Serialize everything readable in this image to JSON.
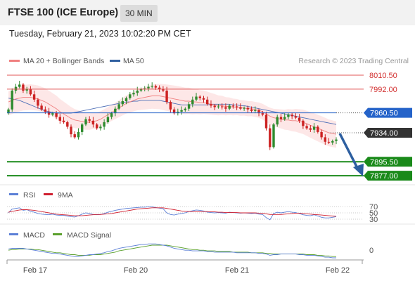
{
  "header": {
    "title": "FTSE 100 (ICE Europe)",
    "interval": "30 MIN"
  },
  "datetime": "Tuesday, February 21, 2023 10:02:20 PM CET",
  "legend": {
    "ma20": "MA 20 + Bollinger Bands",
    "ma50": "MA 50",
    "credit": "Research © 2023 Trading Central"
  },
  "colors": {
    "ma20": "#f08080",
    "ma50": "#3060a0",
    "up": "#2e8b2e",
    "down": "#cc2222",
    "support": "#1a8a1a",
    "resistance": "#e05555",
    "pivot": "#2563c9",
    "price": "#333333",
    "arrow": "#2d5fa0",
    "rsi": "#5b7fd6",
    "rsi_ma": "#d02030",
    "macd": "#5b7fd6",
    "macd_signal": "#5aa02c"
  },
  "chart_data": [
    {
      "type": "line",
      "subtype": "candlestick_with_levels",
      "title": "FTSE 100 (ICE Europe)",
      "x_ticks": [
        "Feb 17",
        "Feb 20",
        "Feb 21",
        "Feb 22"
      ],
      "ylim": [
        7870,
        8020
      ],
      "levels": [
        {
          "value": 8010.5,
          "label": "8010.50",
          "kind": "resistance"
        },
        {
          "value": 7992.0,
          "label": "7992.00",
          "kind": "resistance"
        },
        {
          "value": 7960.5,
          "label": "7960.50",
          "kind": "pivot"
        },
        {
          "value": 7934.0,
          "label": "7934.00",
          "kind": "last"
        },
        {
          "value": 7895.5,
          "label": "7895.50",
          "kind": "support"
        },
        {
          "value": 7877.0,
          "label": "7877.00",
          "kind": "support"
        }
      ],
      "close": [
        7965,
        7990,
        7995,
        7998,
        7990,
        7992,
        7985,
        7978,
        7970,
        7965,
        7962,
        7958,
        7960,
        7955,
        7950,
        7948,
        7942,
        7932,
        7928,
        7935,
        7945,
        7952,
        7950,
        7945,
        7940,
        7942,
        7948,
        7955,
        7960,
        7966,
        7972,
        7976,
        7980,
        7985,
        7987,
        7990,
        7992,
        7993,
        7995,
        7996,
        7994,
        7992,
        7990,
        7975,
        7965,
        7960,
        7962,
        7964,
        7966,
        7972,
        7978,
        7982,
        7980,
        7978,
        7972,
        7970,
        7968,
        7969,
        7968,
        7966,
        7970,
        7969,
        7968,
        7966,
        7967,
        7965,
        7963,
        7964,
        7960,
        7958,
        7940,
        7915,
        7945,
        7955,
        7952,
        7955,
        7958,
        7956,
        7954,
        7950,
        7943,
        7940,
        7938,
        7942,
        7935,
        7928,
        7922,
        7921,
        7923,
        7925
      ],
      "ma20": [
        7975,
        7977,
        7979,
        7980,
        7981,
        7981,
        7981,
        7980,
        7979,
        7977,
        7975,
        7972,
        7969,
        7966,
        7962,
        7959,
        7956,
        7953,
        7951,
        7950,
        7949,
        7948,
        7948,
        7949,
        7950,
        7952,
        7955,
        7958,
        7961,
        7964,
        7967,
        7970,
        7973,
        7975,
        7977,
        7979,
        7980,
        7981,
        7982,
        7983,
        7983,
        7983,
        7982,
        7981,
        7980,
        7979,
        7978,
        7977,
        7976,
        7976,
        7975,
        7975,
        7974,
        7974,
        7973,
        7972,
        7971,
        7970,
        7970,
        7969,
        7969,
        7968,
        7968,
        7967,
        7967,
        7966,
        7966,
        7965,
        7964,
        7962,
        7959,
        7956,
        7954,
        7953,
        7952,
        7951,
        7951,
        7950,
        7950,
        7949,
        7948,
        7946,
        7944,
        7942,
        7940,
        7938,
        7936,
        7934,
        7933,
        7932
      ],
      "ma50": [
        7980,
        7979,
        7978,
        7977,
        7975,
        7973,
        7971,
        7969,
        7967,
        7965,
        7963,
        7962,
        7961,
        7960,
        7960,
        7960,
        7960,
        7960,
        7961,
        7962,
        7963,
        7964,
        7965,
        7966,
        7967,
        7968,
        7969,
        7970,
        7971,
        7972,
        7973,
        7974,
        7975,
        7975,
        7976,
        7976,
        7977,
        7977,
        7977,
        7977,
        7977,
        7977,
        7976,
        7975,
        7974,
        7973,
        7972,
        7971,
        7971,
        7971,
        7971,
        7971,
        7971,
        7971,
        7971,
        7972,
        7972,
        7972,
        7972,
        7972,
        7972,
        7971,
        7971,
        7970,
        7970,
        7969,
        7968,
        7967,
        7966,
        7965,
        7964,
        7963,
        7962,
        7961,
        7960,
        7959,
        7958,
        7957,
        7956,
        7955,
        7954,
        7953,
        7952,
        7951,
        7950,
        7949,
        7948,
        7947,
        7946,
        7945
      ]
    },
    {
      "type": "line",
      "title": "RSI",
      "series": [
        {
          "name": "RSI"
        },
        {
          "name": "9MA"
        }
      ],
      "y_ticks": [
        70,
        50,
        30
      ],
      "ylim": [
        0,
        100
      ],
      "rsi": [
        50,
        62,
        64,
        66,
        58,
        60,
        55,
        52,
        48,
        46,
        45,
        44,
        46,
        43,
        42,
        42,
        40,
        38,
        37,
        41,
        46,
        50,
        48,
        45,
        44,
        45,
        48,
        52,
        55,
        58,
        60,
        62,
        64,
        65,
        66,
        67,
        68,
        68,
        69,
        69,
        67,
        65,
        63,
        50,
        45,
        43,
        46,
        48,
        50,
        54,
        57,
        59,
        58,
        56,
        52,
        51,
        50,
        51,
        50,
        49,
        52,
        51,
        50,
        49,
        50,
        49,
        48,
        49,
        46,
        45,
        35,
        28,
        48,
        52,
        50,
        52,
        54,
        52,
        51,
        48,
        44,
        42,
        41,
        44,
        40,
        36,
        34,
        34,
        36,
        38
      ],
      "rsi_ma": [
        52,
        55,
        57,
        59,
        60,
        60,
        59,
        58,
        56,
        54,
        52,
        50,
        48,
        46,
        45,
        44,
        43,
        42,
        41,
        41,
        41,
        42,
        43,
        44,
        45,
        45,
        46,
        47,
        48,
        50,
        52,
        54,
        56,
        58,
        60,
        62,
        63,
        64,
        65,
        66,
        66,
        66,
        66,
        64,
        62,
        60,
        58,
        56,
        55,
        54,
        54,
        54,
        54,
        54,
        54,
        53,
        53,
        52,
        52,
        51,
        51,
        51,
        51,
        50,
        50,
        50,
        50,
        50,
        49,
        49,
        47,
        45,
        45,
        45,
        45,
        46,
        47,
        48,
        49,
        49,
        48,
        47,
        46,
        45,
        44,
        43,
        42,
        41,
        40,
        39
      ]
    },
    {
      "type": "line",
      "title": "MACD",
      "series": [
        {
          "name": "MACD"
        },
        {
          "name": "MACD Signal"
        }
      ],
      "y_ticks": [
        0
      ],
      "ylim": [
        -15,
        15
      ],
      "macd": [
        4,
        5,
        5,
        5,
        5,
        4,
        3,
        2,
        1,
        0,
        -1,
        -2,
        -3,
        -3,
        -4,
        -5,
        -6,
        -7,
        -8,
        -8,
        -7,
        -6,
        -5,
        -5,
        -4,
        -3,
        -2,
        0,
        1,
        3,
        5,
        6,
        7,
        8,
        9,
        10,
        11,
        11,
        12,
        12,
        12,
        11,
        10,
        9,
        7,
        5,
        4,
        3,
        2,
        2,
        1,
        1,
        1,
        1,
        0,
        0,
        -1,
        -1,
        -1,
        -1,
        -1,
        -1,
        -2,
        -2,
        -2,
        -2,
        -2,
        -2,
        -3,
        -3,
        -4,
        -6,
        -5,
        -5,
        -4,
        -4,
        -4,
        -4,
        -4,
        -5,
        -5,
        -6,
        -6,
        -6,
        -7,
        -8,
        -9,
        -9,
        -10,
        -10
      ],
      "signal": [
        2,
        3,
        3,
        4,
        4,
        4,
        4,
        3,
        3,
        2,
        1,
        0,
        -1,
        -2,
        -2,
        -3,
        -4,
        -5,
        -5,
        -6,
        -6,
        -6,
        -6,
        -5,
        -5,
        -5,
        -4,
        -3,
        -2,
        -1,
        1,
        2,
        3,
        4,
        5,
        6,
        7,
        8,
        9,
        10,
        10,
        10,
        10,
        10,
        9,
        8,
        7,
        6,
        5,
        4,
        3,
        3,
        2,
        2,
        1,
        1,
        1,
        0,
        0,
        0,
        0,
        -1,
        -1,
        -1,
        -1,
        -1,
        -2,
        -2,
        -2,
        -2,
        -3,
        -3,
        -4,
        -4,
        -4,
        -4,
        -4,
        -4,
        -4,
        -4,
        -4,
        -5,
        -5,
        -5,
        -6,
        -6,
        -7,
        -7,
        -8,
        -8
      ]
    }
  ],
  "rsi_legend": {
    "rsi": "RSI",
    "ma": "9MA"
  },
  "macd_legend": {
    "macd": "MACD",
    "signal": "MACD Signal"
  }
}
